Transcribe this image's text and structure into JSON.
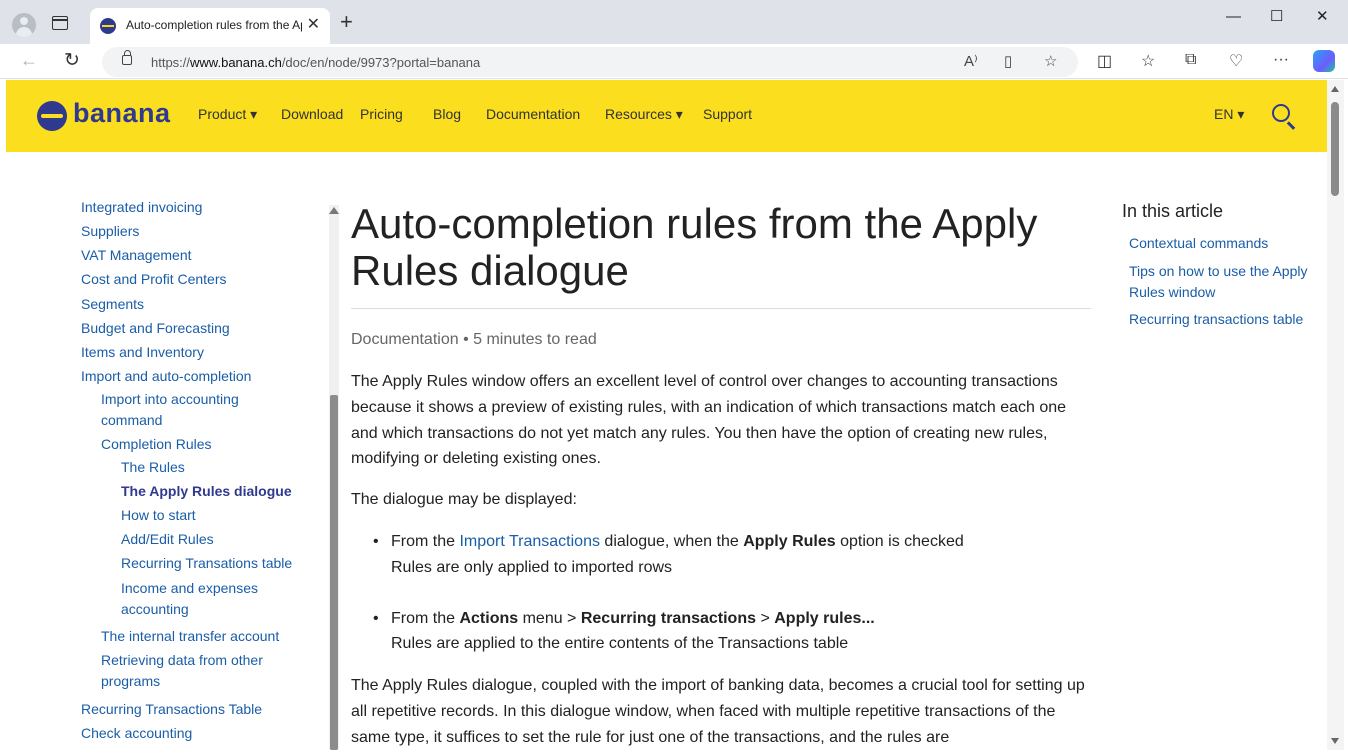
{
  "browser": {
    "tab_title": "Auto-completion rules from the Apply Rules dialogue",
    "url_prefix": "https://",
    "url_domain": "www.banana.ch",
    "url_path": "/doc/en/node/9973?portal=banana",
    "new_tab": "+",
    "close_tab": "✕",
    "win_minimize": "—",
    "win_maximize": "☐",
    "win_close": "✕"
  },
  "header": {
    "logo_text": "banana",
    "menu": [
      {
        "label": "Product ▾"
      },
      {
        "label": "Download"
      },
      {
        "label": "Pricing"
      },
      {
        "label": "Blog"
      },
      {
        "label": "Documentation"
      },
      {
        "label": "Resources ▾"
      },
      {
        "label": "Support"
      }
    ],
    "language": "EN ▾"
  },
  "sidebar": {
    "items": [
      {
        "label": "Integrated invoicing"
      },
      {
        "label": "Suppliers"
      },
      {
        "label": "VAT Management"
      },
      {
        "label": "Cost and Profit Centers"
      },
      {
        "label": "Segments"
      },
      {
        "label": "Budget and Forecasting"
      },
      {
        "label": "Items and Inventory"
      },
      {
        "label": "Import and auto-completion"
      },
      {
        "label": "Import into accounting command"
      },
      {
        "label": "Completion Rules"
      },
      {
        "label": "The Rules"
      },
      {
        "label": "The Apply Rules dialogue"
      },
      {
        "label": "How to start"
      },
      {
        "label": "Add/Edit Rules"
      },
      {
        "label": "Recurring Transations table"
      },
      {
        "label": "Income and expenses accounting"
      },
      {
        "label": "The internal transfer account"
      },
      {
        "label": "Retrieving data from other programs"
      },
      {
        "label": "Recurring Transactions Table"
      },
      {
        "label": "Check accounting"
      }
    ]
  },
  "article": {
    "title": "Auto-completion rules from the Apply Rules dialogue",
    "meta": "Documentation • 5 minutes to read",
    "p1": "The Apply Rules window offers an excellent level of control over changes to accounting transactions because it shows a preview of existing rules, with an indication of which transactions match each one and which transactions do not yet match any rules. You then have the option of creating new rules, modifying or deleting existing ones.",
    "p2": "The dialogue may be displayed:",
    "b1_pre": "From the ",
    "b1_link": "Import Transactions",
    "b1_mid": " dialogue, when the ",
    "b1_bold": "Apply Rules",
    "b1_post": " option is checked",
    "b1_sub": "Rules are only applied to imported rows",
    "b2_pre": "From the ",
    "b2_bold1": "Actions",
    "b2_mid1": " menu > ",
    "b2_bold2": "Recurring transactions",
    "b2_mid2": " > ",
    "b2_bold3": "Apply rules...",
    "b2_sub": "Rules are applied to the entire contents of the Transactions table",
    "p3": "The Apply Rules dialogue, coupled with the import of banking data, becomes a crucial tool for setting up all repetitive records. In this dialogue window, when faced with multiple repetitive transactions of the same type, it suffices to set the rule for just one of the transactions, and the rules are"
  },
  "toc": {
    "title": "In this article",
    "items": [
      {
        "label": "Contextual commands"
      },
      {
        "label": "Tips on how to use the Apply Rules window"
      },
      {
        "label": "Recurring transactions table"
      }
    ]
  }
}
